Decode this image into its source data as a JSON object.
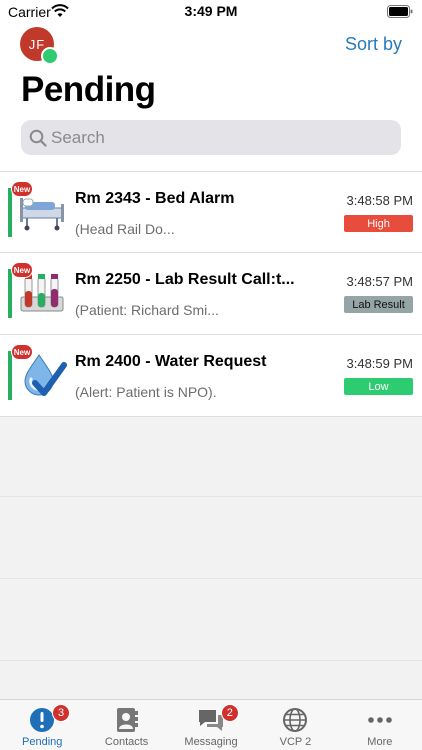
{
  "status_bar": {
    "carrier": "Carrier",
    "time": "3:49 PM"
  },
  "header": {
    "avatar_initials": "JF",
    "sort_label": "Sort by",
    "title": "Pending",
    "search_placeholder": "Search"
  },
  "alerts": [
    {
      "badge": "New",
      "title": "Rm 2343 - Bed Alarm",
      "subtitle": "(Head Rail Do...",
      "time": "3:48:58 PM",
      "tag": "High",
      "icon": "hospital-bed-icon"
    },
    {
      "badge": "New",
      "title": "Rm 2250 - Lab Result Call:t...",
      "subtitle": "(Patient: Richard Smi...",
      "time": "3:48:57 PM",
      "tag": "Lab Result",
      "icon": "test-tubes-icon"
    },
    {
      "badge": "New",
      "title": "Rm 2400 - Water Request",
      "subtitle": "(Alert: Patient is NPO).",
      "time": "3:48:59 PM",
      "tag": "Low",
      "icon": "water-drop-check-icon"
    }
  ],
  "tabs": [
    {
      "label": "Pending",
      "badge": "3",
      "icon": "alert-circle-icon",
      "active": true
    },
    {
      "label": "Contacts",
      "badge": "",
      "icon": "contacts-book-icon",
      "active": false
    },
    {
      "label": "Messaging",
      "badge": "2",
      "icon": "chat-bubbles-icon",
      "active": false
    },
    {
      "label": "VCP 2",
      "badge": "",
      "icon": "globe-icon",
      "active": false
    },
    {
      "label": "More",
      "badge": "",
      "icon": "more-dots-icon",
      "active": false
    }
  ],
  "colors": {
    "accent": "#1f6fb8",
    "high": "#e74c3c",
    "lab": "#95a5a6",
    "low": "#2ecc71",
    "badge": "#d0312d"
  }
}
